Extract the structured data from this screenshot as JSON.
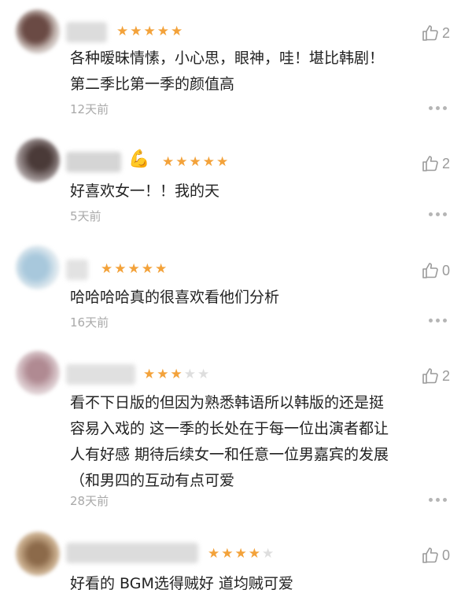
{
  "colors": {
    "star_on": "#f3a23a",
    "star_off": "#dedede",
    "meta": "#a9a9a9"
  },
  "reviews": [
    {
      "stars": 5,
      "likes": "2",
      "lines": [
        "各种暧昧情愫，小心思，眼神，哇！堪比韩剧！",
        "第二季比第一季的颜值高"
      ],
      "time": "12天前"
    },
    {
      "stars": 5,
      "likes": "2",
      "emoji": "💪",
      "lines": [
        "好喜欢女一！！我的天"
      ],
      "time": "5天前"
    },
    {
      "stars": 5,
      "likes": "0",
      "lines": [
        "哈哈哈哈真的很喜欢看他们分析"
      ],
      "time": "16天前"
    },
    {
      "stars": 3,
      "likes": "2",
      "lines": [
        "看不下日版的但因为熟悉韩语所以韩版的还是挺",
        "容易入戏的 这一季的长处在于每一位出演者都让",
        "人有好感 期待后续女一和任意一位男嘉宾的发展",
        "（和男四的互动有点可爱"
      ],
      "time": "28天前"
    },
    {
      "stars": 4,
      "likes": "0",
      "lines": [
        "好看的 BGM选得贼好 道均贼可爱"
      ],
      "time": ""
    }
  ]
}
